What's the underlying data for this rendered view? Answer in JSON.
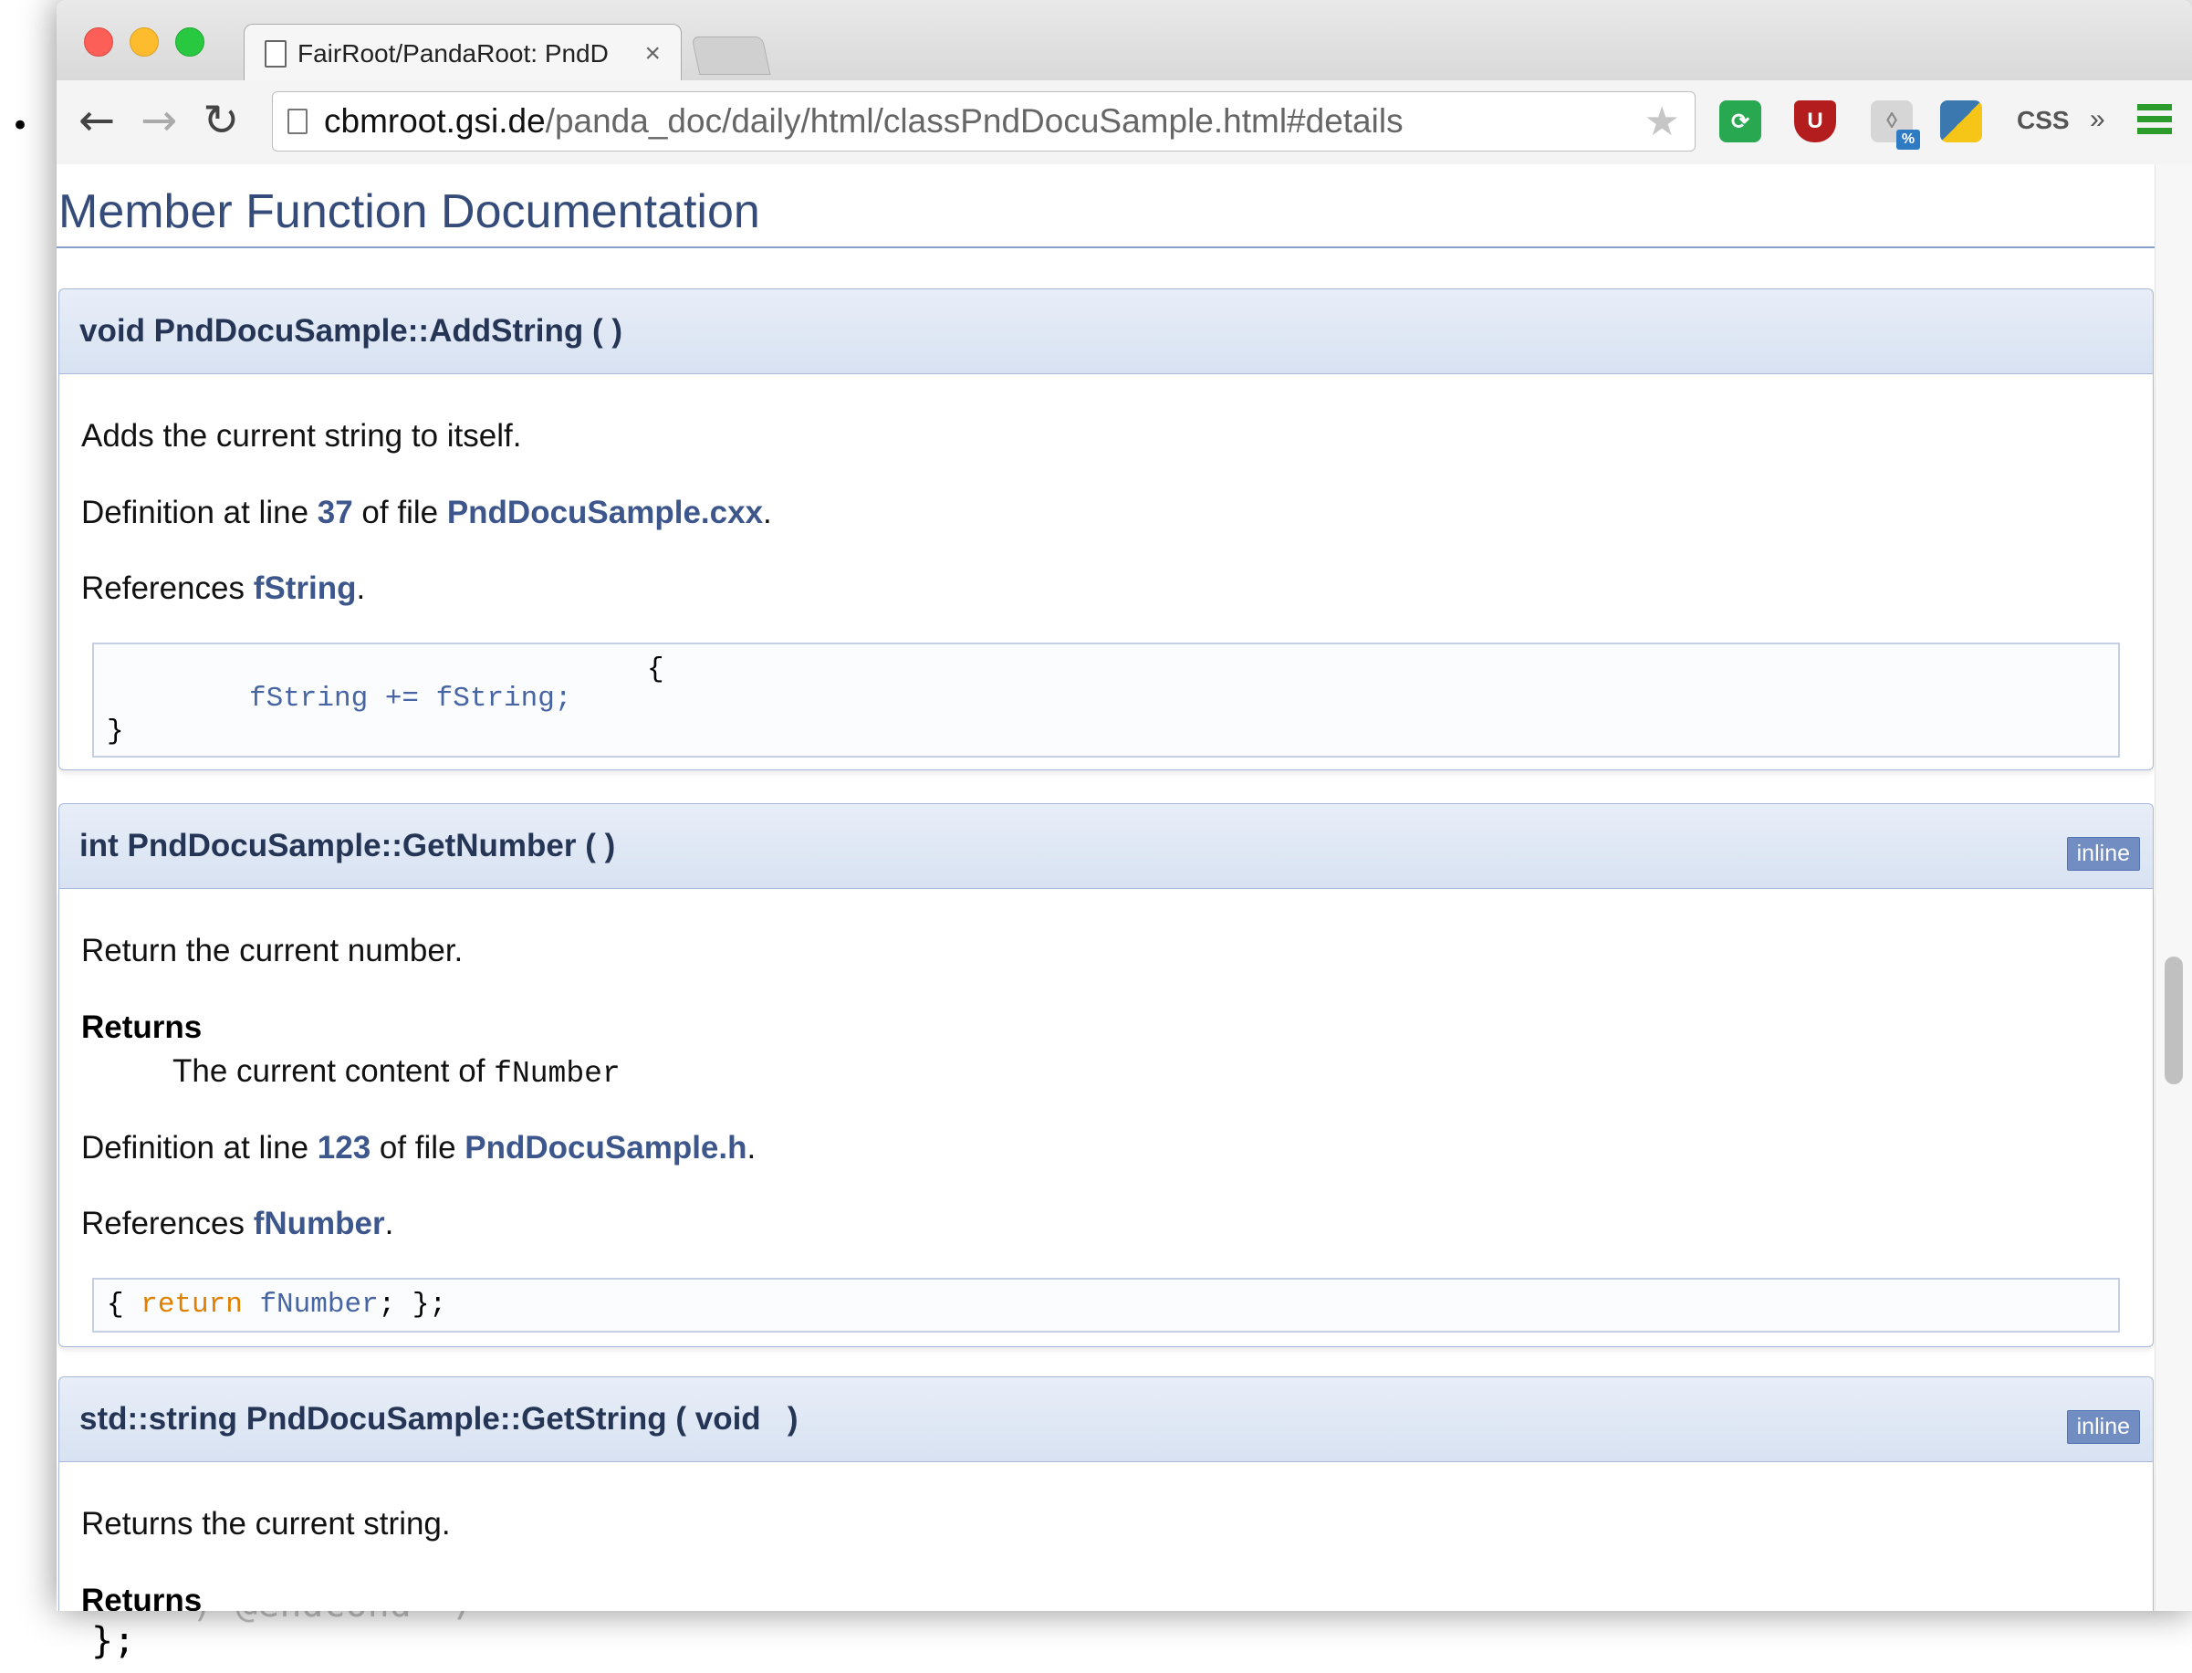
{
  "background": {
    "bullet": "•",
    "code_closing": "};",
    "ghost_text": ")      @endcond   */"
  },
  "browser": {
    "tab_title": "FairRoot/PandaRoot: PndD",
    "tab_close": "×",
    "url_host": "cbmroot.gsi.de",
    "url_path": "/panda_doc/daily/html/classPndDocuSample.html#details",
    "extensions": {
      "css_label": "CSS",
      "more": "»",
      "percent_badge": "%"
    }
  },
  "page": {
    "heading": "Member Function Documentation",
    "members": [
      {
        "signature": "void PndDocuSample::AddString ( )",
        "brief": "Adds the current string to itself.",
        "def_prefix": "Definition at line ",
        "def_line": "37",
        "def_mid": " of file ",
        "def_file": "PndDocuSample.cxx",
        "def_end": ".",
        "refs_prefix": "References ",
        "refs_target": "fString",
        "refs_end": ".",
        "code_line1": "{",
        "code_line2": "fString += fString;",
        "code_line3": "}"
      },
      {
        "signature": "int PndDocuSample::GetNumber ( )",
        "badge": "inline",
        "brief": "Return the current number.",
        "returns_label": "Returns",
        "returns_text": "The current content of ",
        "returns_code": "fNumber",
        "def_prefix": "Definition at line ",
        "def_line": "123",
        "def_mid": " of file ",
        "def_file": "PndDocuSample.h",
        "def_end": ".",
        "refs_prefix": "References ",
        "refs_target": "fNumber",
        "refs_end": ".",
        "code_open": "{ ",
        "code_kw": "return",
        "code_var": " fNumber",
        "code_close": "; };"
      },
      {
        "signature": "std::string PndDocuSample::GetString ( void   )",
        "badge": "inline",
        "brief": "Returns the current string.",
        "returns_label": "Returns"
      }
    ]
  }
}
